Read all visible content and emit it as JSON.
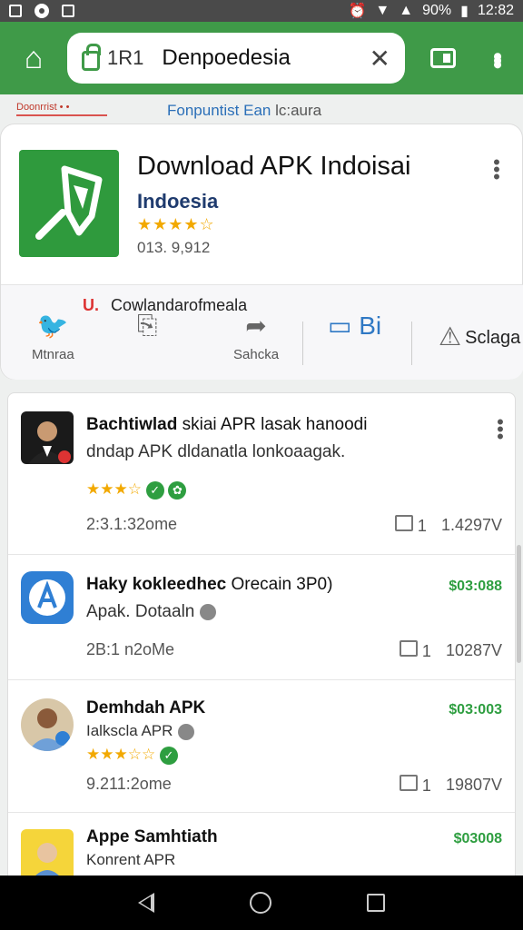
{
  "status_bar": {
    "battery": "90%",
    "time": "12:82"
  },
  "browser": {
    "url_prefix": "1R1",
    "url_site": "Denpoedesia"
  },
  "subheader": {
    "red_text": "Doonrrist • •",
    "title_blue": "Fonpuntist Ean",
    "title_rest": "lc:aura"
  },
  "app": {
    "title": "Download APK Indoisai",
    "developer": "Indoesia",
    "stars": "★★★★☆",
    "count": "013. 9,912",
    "promo_mark": "U.",
    "promo_text": "Cowlandarofmeala",
    "actions": [
      {
        "icon": "bird-icon",
        "label": "Mtnraa"
      },
      {
        "icon": "share-icon",
        "label": ""
      },
      {
        "icon": "forward-icon",
        "label": "Sahcka"
      },
      {
        "icon": "bi-icon",
        "label": "Bi"
      },
      {
        "icon": "flag-icon",
        "label": "Sclaga"
      }
    ]
  },
  "list": [
    {
      "title_bold": "Bachtiwlad",
      "title_rest": " skiai APR lasak hanoodi",
      "subtitle": "dndap APK dldanatla lonkoaagak.",
      "stars": "★★★☆",
      "date": "2:3.1:32ome",
      "doc_count": "1",
      "size": "1.4297V",
      "price": ""
    },
    {
      "title_bold": "Haky kokleedhec",
      "title_rest": " Orecain 3P0)",
      "subtitle": "Apak. Dotaaln",
      "stars": "",
      "date": "2B:1 n2oMe",
      "doc_count": "1",
      "size": "10287V",
      "price": "$03:088"
    },
    {
      "title_bold": "Demhdah APK",
      "title_rest": "",
      "subtitle": "Ialkscla APR",
      "stars": "★★★☆☆",
      "date": "9.211:2ome",
      "doc_count": "1",
      "size": "19807V",
      "price": "$03:003"
    },
    {
      "title_bold": "Appe Samhtiath",
      "title_rest": "",
      "subtitle": "Konrent APR",
      "stars": "",
      "date": "",
      "doc_count": "",
      "size": "",
      "price": "$03008"
    }
  ]
}
